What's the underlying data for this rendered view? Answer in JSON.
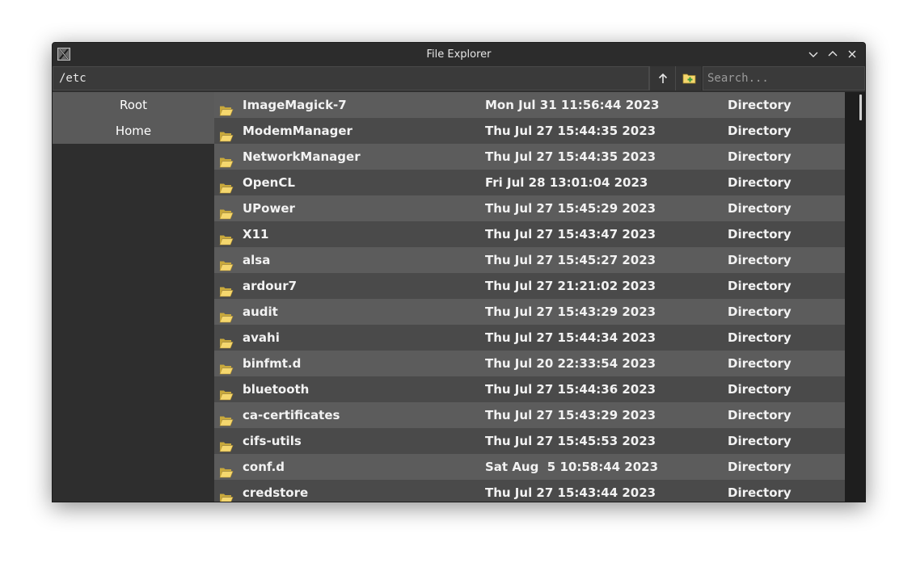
{
  "window": {
    "title": "File Explorer"
  },
  "toolbar": {
    "path_value": "/etc",
    "search_placeholder": "Search..."
  },
  "sidebar": {
    "items": [
      {
        "label": "Root"
      },
      {
        "label": "Home"
      }
    ]
  },
  "files": [
    {
      "name": "ImageMagick-7",
      "date": "Mon Jul 31 11:56:44 2023",
      "type": "Directory"
    },
    {
      "name": "ModemManager",
      "date": "Thu Jul 27 15:44:35 2023",
      "type": "Directory"
    },
    {
      "name": "NetworkManager",
      "date": "Thu Jul 27 15:44:35 2023",
      "type": "Directory"
    },
    {
      "name": "OpenCL",
      "date": "Fri Jul 28 13:01:04 2023",
      "type": "Directory"
    },
    {
      "name": "UPower",
      "date": "Thu Jul 27 15:45:29 2023",
      "type": "Directory"
    },
    {
      "name": "X11",
      "date": "Thu Jul 27 15:43:47 2023",
      "type": "Directory"
    },
    {
      "name": "alsa",
      "date": "Thu Jul 27 15:45:27 2023",
      "type": "Directory"
    },
    {
      "name": "ardour7",
      "date": "Thu Jul 27 21:21:02 2023",
      "type": "Directory"
    },
    {
      "name": "audit",
      "date": "Thu Jul 27 15:43:29 2023",
      "type": "Directory"
    },
    {
      "name": "avahi",
      "date": "Thu Jul 27 15:44:34 2023",
      "type": "Directory"
    },
    {
      "name": "binfmt.d",
      "date": "Thu Jul 20 22:33:54 2023",
      "type": "Directory"
    },
    {
      "name": "bluetooth",
      "date": "Thu Jul 27 15:44:36 2023",
      "type": "Directory"
    },
    {
      "name": "ca-certificates",
      "date": "Thu Jul 27 15:43:29 2023",
      "type": "Directory"
    },
    {
      "name": "cifs-utils",
      "date": "Thu Jul 27 15:45:53 2023",
      "type": "Directory"
    },
    {
      "name": "conf.d",
      "date": "Sat Aug  5 10:58:44 2023",
      "type": "Directory"
    },
    {
      "name": "credstore",
      "date": "Thu Jul 27 15:43:44 2023",
      "type": "Directory"
    }
  ],
  "icons": {
    "app": "x11-app-icon",
    "minimize": "chevron-down-icon",
    "maximize": "chevron-up-icon",
    "close": "close-icon",
    "go_up": "arrow-up-icon",
    "new_folder": "new-folder-icon",
    "folder": "folder-open-icon"
  },
  "colors": {
    "folder": "#f5d76e",
    "new_folder_accent": "#5cb85c"
  }
}
